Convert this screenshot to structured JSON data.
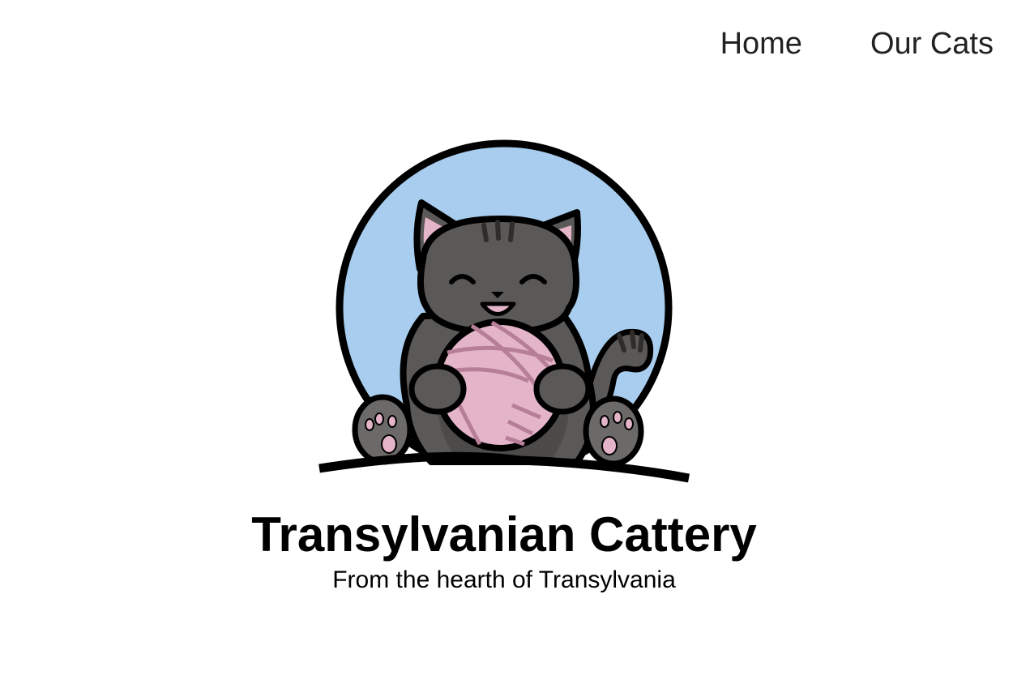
{
  "nav": {
    "items": [
      {
        "label": "Home"
      },
      {
        "label": "Our Cats"
      }
    ]
  },
  "logo": {
    "icon": "cat-with-yarn-ball-logo",
    "colors": {
      "circle": "#a8cdee",
      "cat": "#5a5957",
      "yarn": "#e4b4c8",
      "outline": "#000000"
    }
  },
  "hero": {
    "title": "Transylvanian Cattery",
    "tagline": "From the hearth of Transylvania"
  }
}
